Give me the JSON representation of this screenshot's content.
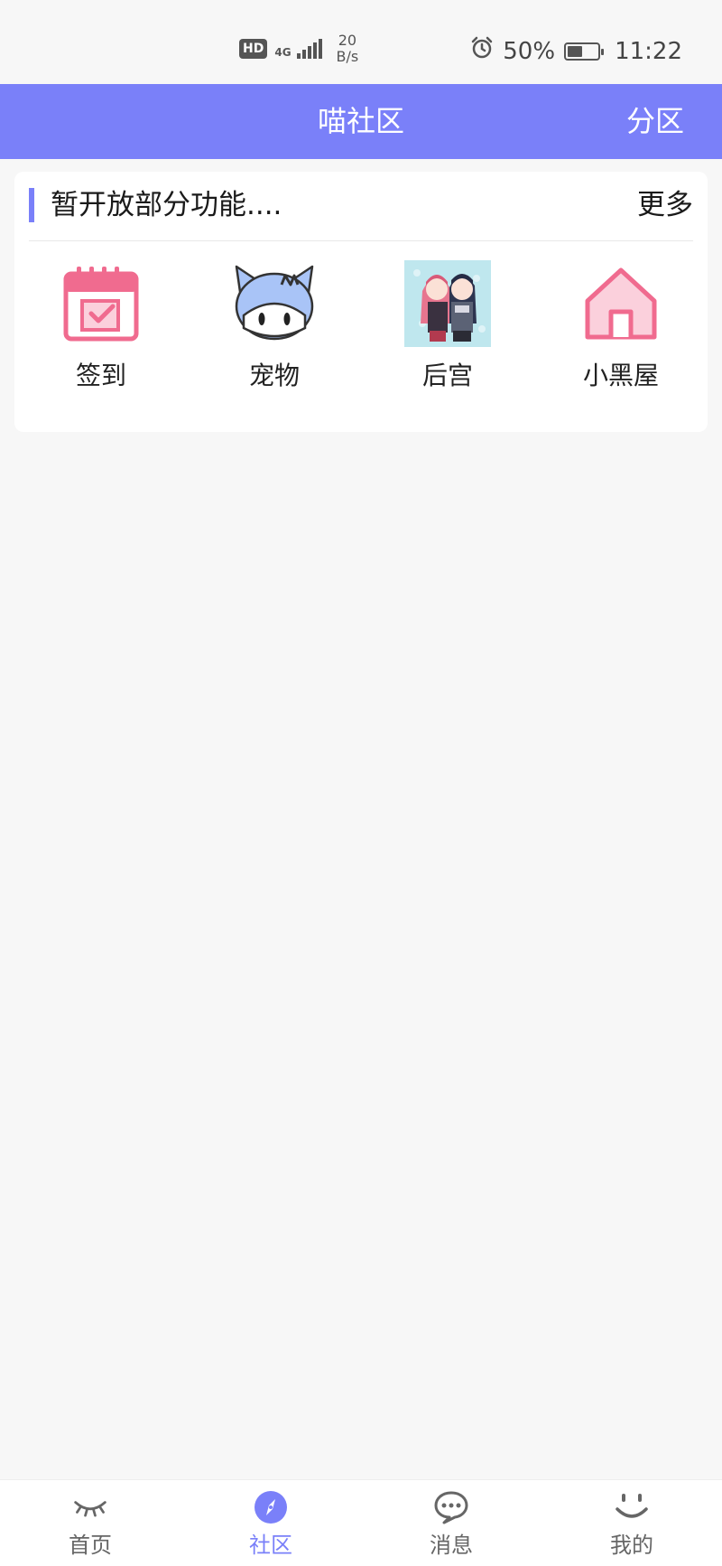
{
  "status_bar": {
    "hd": "HD",
    "network": "4G",
    "speed_value": "20",
    "speed_unit": "B/s",
    "battery": "50%",
    "battery_level": 0.5,
    "time": "11:22"
  },
  "header": {
    "title": "喵社区",
    "right_action": "分区"
  },
  "notice_card": {
    "title": "暂开放部分功能....",
    "more": "更多",
    "items": [
      {
        "label": "签到",
        "icon": "calendar-check-icon"
      },
      {
        "label": "宠物",
        "icon": "cat-avatar-icon"
      },
      {
        "label": "后宫",
        "icon": "anime-girls-image"
      },
      {
        "label": "小黑屋",
        "icon": "house-icon"
      }
    ]
  },
  "tab_bar": {
    "tabs": [
      {
        "label": "首页",
        "icon": "eye-icon",
        "active": false
      },
      {
        "label": "社区",
        "icon": "compass-icon",
        "active": true
      },
      {
        "label": "消息",
        "icon": "chat-icon",
        "active": false
      },
      {
        "label": "我的",
        "icon": "smiley-icon",
        "active": false
      }
    ]
  },
  "colors": {
    "accent": "#7a80f9",
    "pink": "#f06b8f",
    "background": "#f7f7f7"
  }
}
